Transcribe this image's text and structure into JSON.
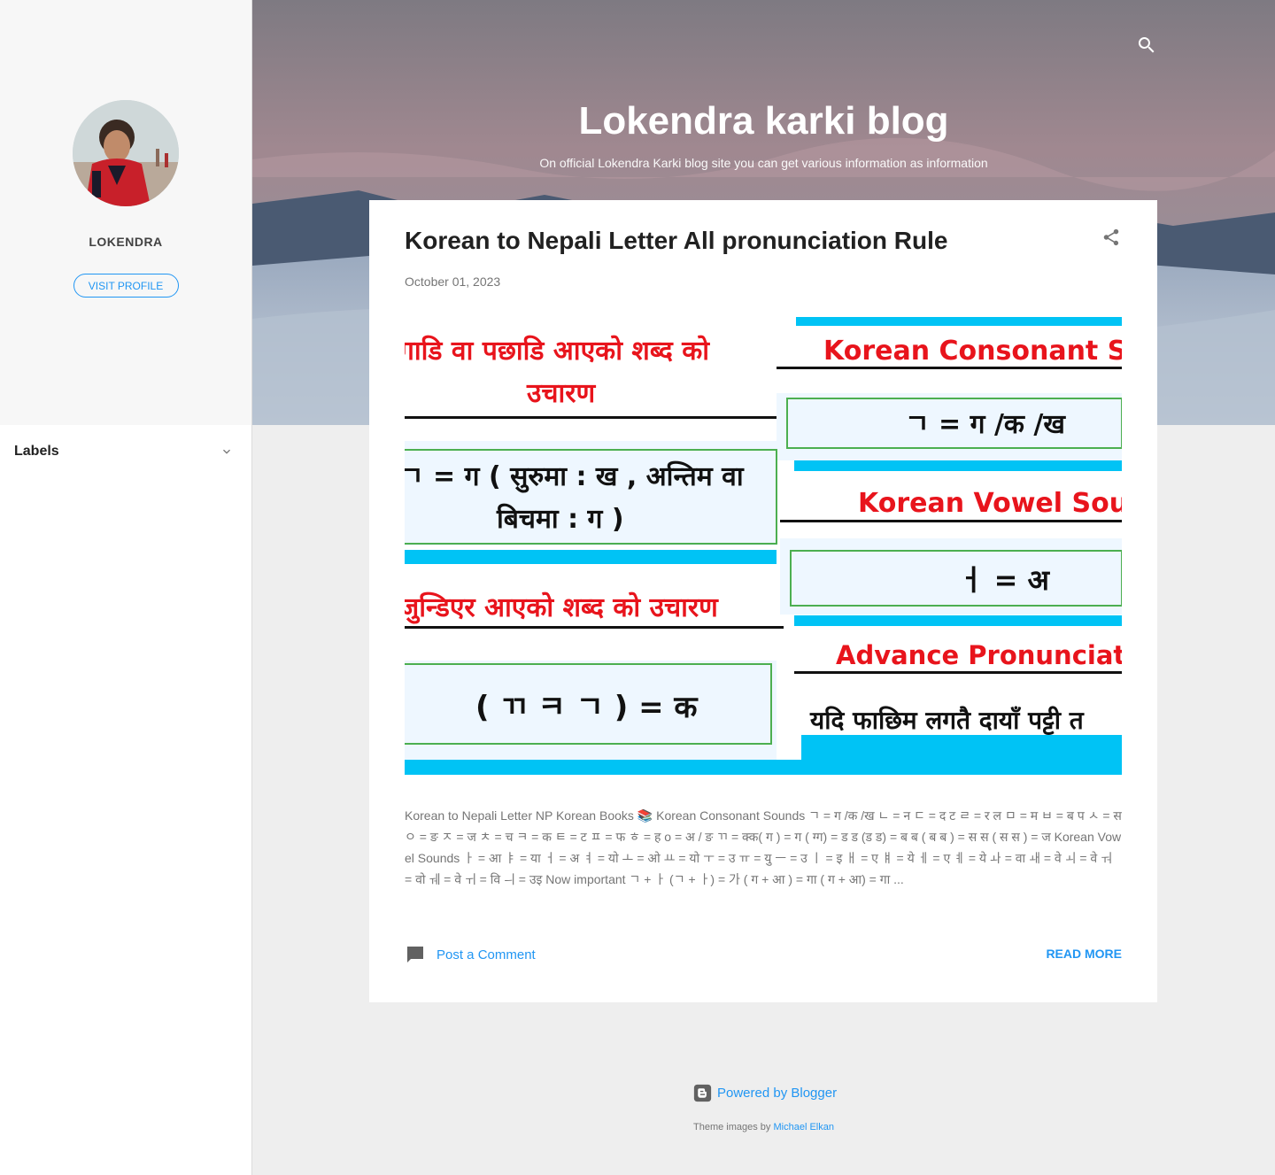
{
  "blog": {
    "title": "Lokendra karki blog",
    "description": "On official Lokendra Karki blog site you can get various information as information"
  },
  "profile": {
    "name": "LOKENDRA",
    "visit_label": "VISIT PROFILE"
  },
  "sidebar": {
    "labels_title": "Labels"
  },
  "post": {
    "title": "Korean to Nepali Letter All pronunciation Rule",
    "date": "October 01, 2023",
    "image_text": {
      "left_heading_1": "गाडि वा पछाडि आएको शब्द को",
      "left_heading_2": "उचारण",
      "left_box_1": "ㄱ = ग ( सुरुमा : ख , अन्तिम वा",
      "left_box_2": "बिचमा : ग )",
      "left_heading_3": "जुन्डिएर आएको शब्द को उचारण",
      "left_box_3": "( ㄲ ㅋ ㄱ ) = क",
      "right_heading_1": "Korean Consonant Sounds",
      "right_box_1": "ㄱ = ग /क /ख",
      "right_heading_2": "Korean Vowel Sounds",
      "right_box_2": "ㅓ = अ",
      "right_heading_3": "Advance Pronunciation",
      "right_text_4": "यदि फाछिम लगतै दायाँ पट्टी त"
    },
    "snippet": "Korean to Nepali Letter NP Korean Books 📚 Korean Consonant Sounds ㄱ = ग /क /ख ㄴ = न ㄷ = द ट ㄹ = र ल ㅁ = म ㅂ = ब प ㅅ = स ㅇ = ङ ㅈ = ज ㅊ = च ㅋ = क ㅌ = ट ㅍ = फ ㅎ = ह o = अ / ङ ㄲ = क्क( ग ) = ग ( ग्ग) = ड ड (ड ड) = ब ब ( ब ब ) = स स ( स स ) = ज Korean Vowel Sounds ㅏ = आ ㅑ = या ㅓ = अ ㅕ = यो ㅗ = ओ ㅛ = यो ㅜ = उ ㅠ = यु ㅡ = उ ㅣ = इ ㅐ = ए ㅒ = ये ㅔ = ए ㅖ = ये ㅘ = वा ㅙ = वे ㅚ = वे ㅝ = वो ㅞ = वे ㅟ = वि ㅢ = उइ Now important ㄱ + ㅏ (ㄱ + ㅏ) = 가 ( ग + आ ) = गा ( ग + आ) = गा ...",
    "comment_label": "Post a Comment",
    "read_more": "READ MORE"
  },
  "footer": {
    "powered_by": "Powered by Blogger",
    "credit_prefix": "Theme images by",
    "credit_name": "Michael Elkan"
  },
  "colors": {
    "accent": "#2196f3",
    "image_cyan": "#00c3f5",
    "image_red": "#e8141c",
    "box_green": "#4caf50"
  },
  "icons": [
    "search-icon",
    "share-icon",
    "comment-icon",
    "chevron-down-icon",
    "blogger-icon"
  ]
}
